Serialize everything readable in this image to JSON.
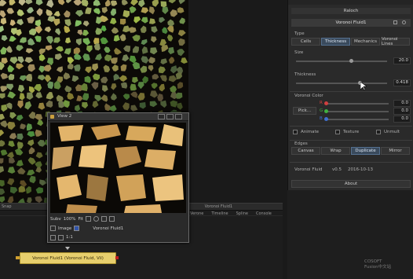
{
  "viewer_strip": {
    "left_label": "Snap",
    "tabs": [
      "Voronoi Fluid1",
      "Verone",
      "Timeline",
      "Spline",
      "Console"
    ]
  },
  "float_view": {
    "title": "View 2",
    "zoom": "Subv",
    "scale": "100%",
    "fit_label": "Fit",
    "image_label": "Image",
    "node_label": "Voronoi Fluid1",
    "frame": "1:1"
  },
  "node": {
    "label": "Voronoi Fluid1 (Voronoi Fluid, Vil)"
  },
  "inspector": {
    "header_title": "Raloch",
    "tool_title": "Voronoi Fluid1",
    "type_label": "Type",
    "type_options": [
      "Cells",
      "Thickness",
      "Mechanics",
      "Voronoi Lines"
    ],
    "type_selected": 1,
    "size_label": "Size",
    "size_value": "20.0",
    "size_fraction": 0.6,
    "thickness_label": "Thickness",
    "thickness_value": "0.418",
    "thickness_fraction": 0.7,
    "color_label": "Voronoi Color",
    "pick_label": "Pick...",
    "channels": [
      {
        "name": "R",
        "value": "0.0",
        "color": "#d04040"
      },
      {
        "name": "G",
        "value": "0.0",
        "color": "#40b040"
      },
      {
        "name": "B",
        "value": "0.0",
        "color": "#4070d0"
      }
    ],
    "checkboxes": [
      "Animate",
      "Texture",
      "Unmult"
    ],
    "edges_label": "Edges",
    "edge_options": [
      "Canvas",
      "Wrap",
      "Duplicate",
      "Mirror"
    ],
    "edge_selected": 2,
    "footer_left": "Voronoi Fluid",
    "footer_mid": "v0.5",
    "footer_right": "2016-10-13",
    "about_label": "About"
  },
  "watermark": {
    "line1": "COSOFT",
    "line2": "Fusion中文站"
  },
  "colors": {
    "node_fill": "#e7cf6d",
    "selected": "#3a4a5c",
    "cell_light": "#d6b06a"
  }
}
